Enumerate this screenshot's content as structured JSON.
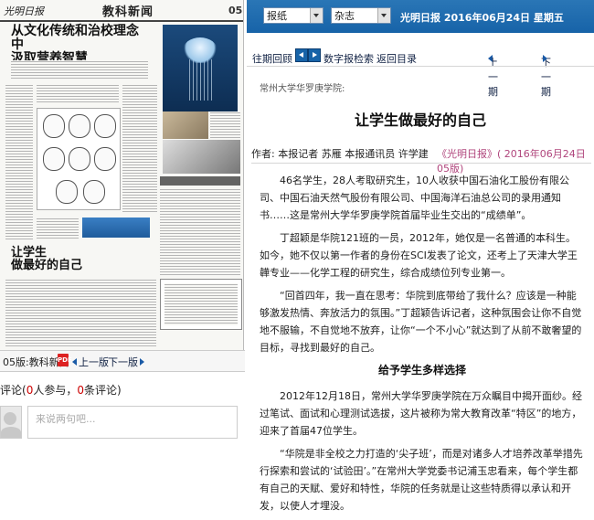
{
  "page_thumbnail": {
    "masthead": "光明日报",
    "section": "教科新闻",
    "page_number": "05",
    "lead_headline_line1": "从文化传统和治校理念中",
    "lead_headline_line2": "汲取营养智慧",
    "bottom_headline_line1": "让学生",
    "bottom_headline_line2": "做最好的自己"
  },
  "left_footer": {
    "issue_label": "05版:教科新闻",
    "prev_label": "上一版",
    "next_label": "下一版"
  },
  "comments": {
    "prefix": "评论(",
    "participants": "0",
    "participants_suffix": "人参与，",
    "count": "0",
    "count_suffix": "条评论)",
    "placeholder": "来说两句吧..."
  },
  "toolbar": {
    "select_1": "报纸",
    "select_2": "杂志",
    "info": "光明日报  2016年06月24日  星期五"
  },
  "nav": {
    "back_label": "往期回顾",
    "digital_search": "数字报检索",
    "home_label": "返回目录",
    "prev_article": "上一期",
    "next_article": "下一期"
  },
  "article": {
    "kicker": "常州大学华罗庚学院:",
    "title": "让学生做最好的自己",
    "byline": "作者: 本报记者  苏雁  本报通讯员  许学建",
    "source": "《光明日报》( 2016年06月24日  05版)",
    "paragraphs": [
      "46名学生，28人考取研究生，10人收获中国石油化工股份有限公司、中国石油天然气股份有限公司、中国海洋石油总公司的录用通知书……这是常州大学华罗庚学院首届毕业生交出的“成绩单”。",
      "丁超颖是华院121班的一员，2012年，她仅是一名普通的本科生。如今，她不仅以第一作者的身份在SCI发表了论文，还考上了天津大学王韡专业——化学工程的研究生，综合成绩位列专业第一。",
      "“回首四年，我一直在思考：华院到底带给了我什么？应该是一种能够激发热情、奔放活力的氛围。”丁超颖告诉记者，这种氛围会让你不自觉地不服输，不自觉地不放弃，让你“一个不小心”就达到了从前不敢奢望的目标，寻找到最好的自己。"
    ],
    "subheading": "给予学生多样选择",
    "paragraphs_2": [
      "2012年12月18日，常州大学华罗庚学院在万众瞩目中揭开面纱。经过笔试、面试和心理测试选拔，这片被称为常大教育改革“特区”的地方，迎来了首届47位学生。",
      "“华院是非全校之力打造的‘尖子班’，而是对诸多人才培养改革举措先行探索和尝试的‘试验田’。”在常州大学党委书记浦玉忠看来，每个学生都有自己的天赋、爱好和特性，华院的任务就是让这些特质得以承认和开发，以使人才埋没。"
    ]
  },
  "colors": {
    "toolbar_blue": "#1763a8",
    "source_pink": "#b0457c",
    "comment_red": "#cc0000"
  }
}
